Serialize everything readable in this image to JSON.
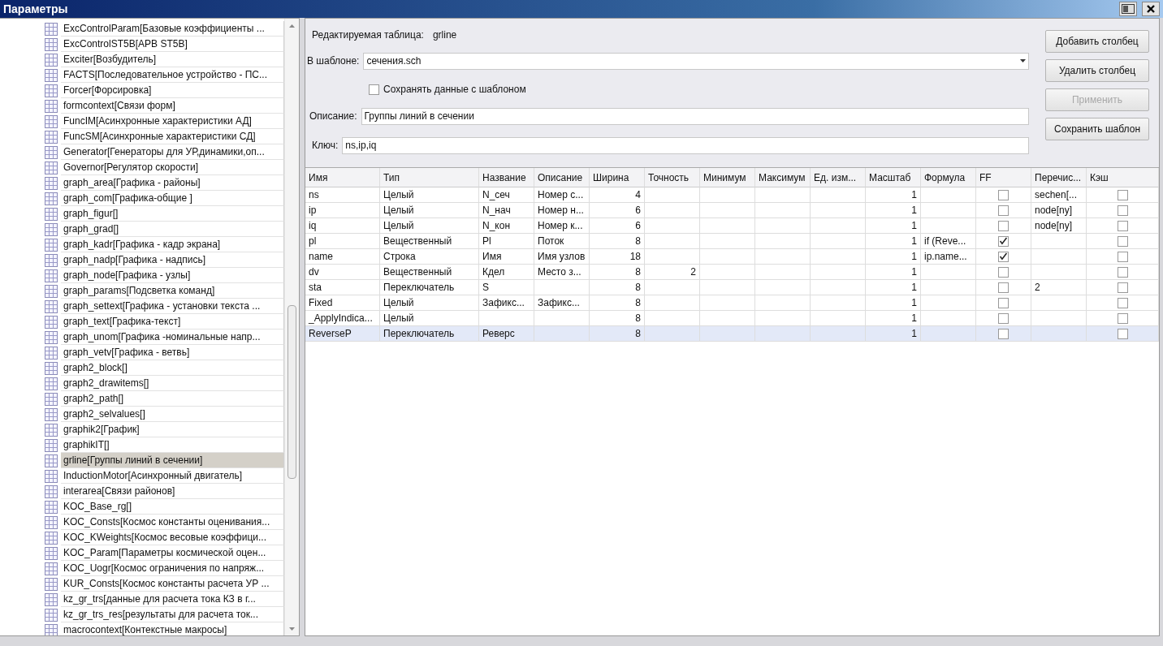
{
  "window": {
    "title": "Параметры"
  },
  "sidebar": {
    "items": [
      {
        "label": "ExcControlParam[Базовые коэффициенты ...",
        "selected": false
      },
      {
        "label": "ExcControlST5B[АРВ ST5B]",
        "selected": false
      },
      {
        "label": "Exciter[Возбудитель]",
        "selected": false
      },
      {
        "label": "FACTS[Последовательное устройство - ПС...",
        "selected": false
      },
      {
        "label": "Forcer[Форсировка]",
        "selected": false
      },
      {
        "label": "formcontext[Связи форм]",
        "selected": false
      },
      {
        "label": "FuncIM[Асинхронные характеристики АД]",
        "selected": false
      },
      {
        "label": "FuncSM[Асинхронные характеристики СД]",
        "selected": false
      },
      {
        "label": "Generator[Генераторы для УР,динамики,оп...",
        "selected": false
      },
      {
        "label": "Governor[Регулятор скорости]",
        "selected": false
      },
      {
        "label": "graph_area[Графика - районы]",
        "selected": false
      },
      {
        "label": "graph_com[Графика-общие ]",
        "selected": false
      },
      {
        "label": "graph_figur[]",
        "selected": false
      },
      {
        "label": "graph_grad[]",
        "selected": false
      },
      {
        "label": "graph_kadr[Графика - кадр экрана]",
        "selected": false
      },
      {
        "label": "graph_nadp[Графика - надпись]",
        "selected": false
      },
      {
        "label": "graph_node[Графика - узлы]",
        "selected": false
      },
      {
        "label": "graph_params[Подсветка команд]",
        "selected": false
      },
      {
        "label": "graph_settext[Графика - установки текста ...",
        "selected": false
      },
      {
        "label": "graph_text[Графика-текст]",
        "selected": false
      },
      {
        "label": "graph_unom[Графика -номинальные напр...",
        "selected": false
      },
      {
        "label": "graph_vetv[Графика - ветвь]",
        "selected": false
      },
      {
        "label": "graph2_block[]",
        "selected": false
      },
      {
        "label": "graph2_drawitems[]",
        "selected": false
      },
      {
        "label": "graph2_path[]",
        "selected": false
      },
      {
        "label": "graph2_selvalues[]",
        "selected": false
      },
      {
        "label": "graphik2[График]",
        "selected": false
      },
      {
        "label": "graphikIT[]",
        "selected": false
      },
      {
        "label": "grline[Группы линий в сечении]",
        "selected": true
      },
      {
        "label": "InductionMotor[Асинхронный двигатель]",
        "selected": false
      },
      {
        "label": "interarea[Связи районов]",
        "selected": false
      },
      {
        "label": "KOC_Base_rg[]",
        "selected": false
      },
      {
        "label": "KOC_Consts[Космос константы оценивания...",
        "selected": false
      },
      {
        "label": "KOC_KWeights[Космос весовые коэффици...",
        "selected": false
      },
      {
        "label": "KOC_Param[Параметры космической оцен...",
        "selected": false
      },
      {
        "label": "KOC_Uogr[Космос ограничения по напряж...",
        "selected": false
      },
      {
        "label": "KUR_Consts[Космос константы расчета УР ...",
        "selected": false
      },
      {
        "label": "kz_gr_trs[данные для расчета тока КЗ в г...",
        "selected": false
      },
      {
        "label": "kz_gr_trs_res[результаты для расчета ток...",
        "selected": false
      },
      {
        "label": "macrocontext[Контекстные макросы]",
        "selected": false
      }
    ]
  },
  "form": {
    "edited_table_label": "Редактируемая таблица:",
    "edited_table": "grline",
    "template_label": "В шаблоне:",
    "template": "сечения.sch",
    "save_with_template": {
      "label": "Сохранять данные с шаблоном",
      "checked": false
    },
    "description_label": "Описание:",
    "description": "Группы линий в сечении",
    "key_label": "Ключ:",
    "key": "ns,ip,iq"
  },
  "buttons": [
    {
      "label": "Добавить столбец",
      "disabled": false
    },
    {
      "label": "Удалить столбец",
      "disabled": false
    },
    {
      "label": "Применить",
      "disabled": true
    },
    {
      "label": "Сохранить шаблон",
      "disabled": false
    }
  ],
  "table": {
    "columns": [
      {
        "label": "Имя",
        "kind": "text"
      },
      {
        "label": "Тип",
        "kind": "text"
      },
      {
        "label": "Название",
        "kind": "text"
      },
      {
        "label": "Описание",
        "kind": "text"
      },
      {
        "label": "Ширина",
        "kind": "number"
      },
      {
        "label": "Точность",
        "kind": "number"
      },
      {
        "label": "Минимум",
        "kind": "number"
      },
      {
        "label": "Максимум",
        "kind": "number"
      },
      {
        "label": "Ед. изм...",
        "kind": "text"
      },
      {
        "label": "Масштаб",
        "kind": "number"
      },
      {
        "label": "Формула",
        "kind": "text"
      },
      {
        "label": "FF",
        "kind": "check"
      },
      {
        "label": "Перечис...",
        "kind": "text"
      },
      {
        "label": "Кэш",
        "kind": "check"
      }
    ],
    "rows": [
      {
        "selected": false,
        "cells": [
          "ns",
          "Целый",
          "N_сеч",
          "Номер с...",
          "4",
          null,
          null,
          null,
          null,
          "1",
          null,
          false,
          "sechen[...",
          false
        ]
      },
      {
        "selected": false,
        "cells": [
          "ip",
          "Целый",
          "N_нач",
          "Номер н...",
          "6",
          null,
          null,
          null,
          null,
          "1",
          null,
          false,
          "node[ny]",
          false
        ]
      },
      {
        "selected": false,
        "cells": [
          "iq",
          "Целый",
          "N_кон",
          "Номер к...",
          "6",
          null,
          null,
          null,
          null,
          "1",
          null,
          false,
          "node[ny]",
          false
        ]
      },
      {
        "selected": false,
        "cells": [
          "pl",
          "Вещественный",
          "Pl",
          "Поток",
          "8",
          null,
          null,
          null,
          null,
          "1",
          "if (Reve...",
          true,
          null,
          false
        ]
      },
      {
        "selected": false,
        "cells": [
          "name",
          "Строка",
          "Имя",
          "Имя узлов",
          "18",
          null,
          null,
          null,
          null,
          "1",
          "ip.name...",
          true,
          null,
          false
        ]
      },
      {
        "selected": false,
        "cells": [
          "dv",
          "Вещественный",
          "Кдел",
          "Место з...",
          "8",
          "2",
          null,
          null,
          null,
          "1",
          null,
          false,
          null,
          false
        ]
      },
      {
        "selected": false,
        "cells": [
          "sta",
          "Переключатель",
          "S",
          null,
          "8",
          null,
          null,
          null,
          null,
          "1",
          null,
          false,
          "2",
          false
        ]
      },
      {
        "selected": false,
        "cells": [
          "Fixed",
          "Целый",
          "Зафикс...",
          "Зафикс...",
          "8",
          null,
          null,
          null,
          null,
          "1",
          null,
          false,
          null,
          false
        ]
      },
      {
        "selected": false,
        "cells": [
          "_ApplyIndica...",
          "Целый",
          null,
          null,
          "8",
          null,
          null,
          null,
          null,
          "1",
          null,
          false,
          null,
          false
        ]
      },
      {
        "selected": true,
        "cells": [
          "ReverseP",
          "Переключатель",
          "Реверс",
          null,
          "8",
          null,
          null,
          null,
          null,
          "1",
          null,
          false,
          null,
          false
        ]
      }
    ]
  }
}
